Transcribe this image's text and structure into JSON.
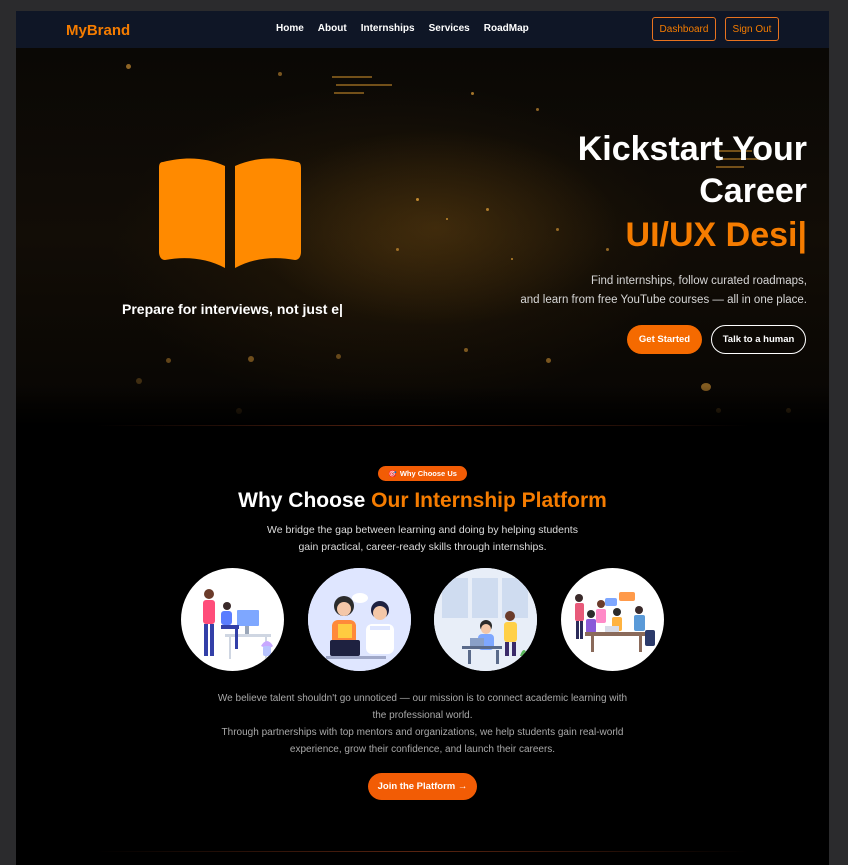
{
  "nav": {
    "brand": "MyBrand",
    "links": [
      "Home",
      "About",
      "Internships",
      "Services",
      "RoadMap"
    ],
    "dashboard": "Dashboard",
    "signout": "Sign Out"
  },
  "hero": {
    "title_line1": "Kickstart Your",
    "title_line2": "Career",
    "typed": "UI/UX Desi|",
    "sub_line1": "Find internships, follow curated roadmaps,",
    "sub_line2": "and learn from free YouTube courses — all in one place.",
    "prep_text": "Prepare for interviews, not just e|",
    "get_started": "Get Started",
    "talk_human": "Talk to a human",
    "book_color": "#ff8a00",
    "accent": "#f57c00"
  },
  "why": {
    "badge_icon": "🎯",
    "badge": "Why Choose Us",
    "title_plain": "Why Choose",
    "title_accent": "Our Internship Platform",
    "sub_line1": "We bridge the gap between learning and doing by helping students",
    "sub_line2": "gain practical, career-ready skills through internships.",
    "mission_line1": "We believe talent shouldn't go unnoticed — our mission is to connect academic learning with",
    "mission_line2": "the professional world.",
    "mission_line3": "Through partnerships with top mentors and organizations, we help students gain real-world",
    "mission_line4": "experience, grow their confidence, and launch their careers.",
    "join": "Join the Platform →",
    "illustrations": [
      "mentor-at-desk-illustration",
      "laptop-collaboration-illustration",
      "office-coworkers-illustration",
      "team-meeting-illustration"
    ]
  }
}
